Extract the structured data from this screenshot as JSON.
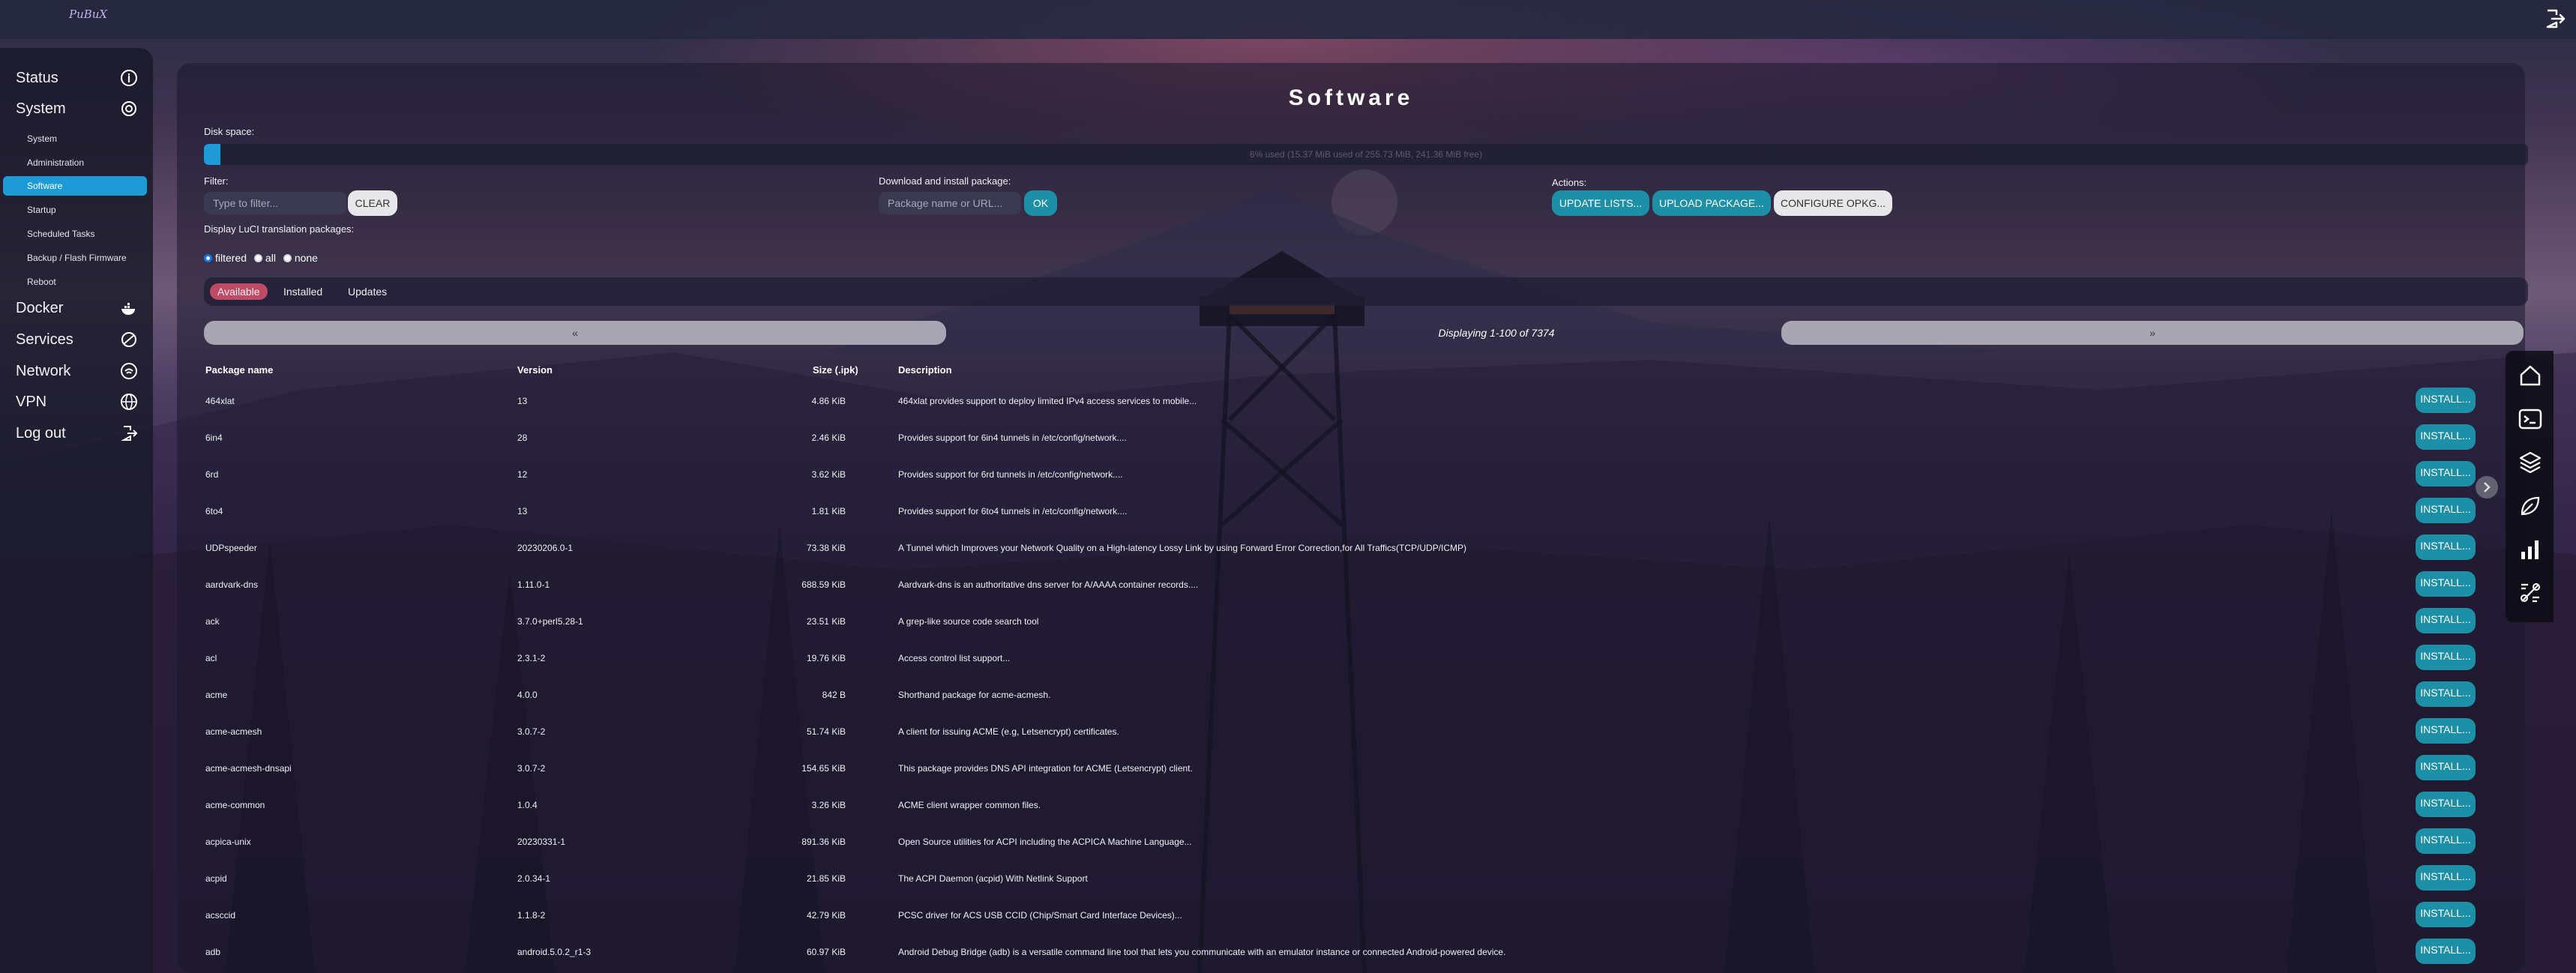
{
  "app": {
    "logo": "PuBuX"
  },
  "sidebar": {
    "items": [
      {
        "label": "Status",
        "icon": "info-circle-icon"
      },
      {
        "label": "System",
        "icon": "gear-icon"
      },
      {
        "label": "Docker",
        "icon": "whale-icon"
      },
      {
        "label": "Services",
        "icon": "services-icon"
      },
      {
        "label": "Network",
        "icon": "wifi-icon"
      },
      {
        "label": "VPN",
        "icon": "globe-icon"
      },
      {
        "label": "Log out",
        "icon": "logout-icon"
      }
    ],
    "system_sub": [
      "System",
      "Administration",
      "Software",
      "Startup",
      "Scheduled Tasks",
      "Backup / Flash Firmware",
      "Reboot"
    ],
    "active_sub": "Software"
  },
  "page": {
    "title": "Software",
    "disk_space_label": "Disk space:",
    "disk_text": "6% used (15.37 MiB used of 255.73 MiB, 241.36 MiB free)",
    "disk_used_fraction": 0.06,
    "filter_label": "Filter:",
    "filter_placeholder": "Type to filter...",
    "clear_label": "CLEAR",
    "download_label": "Download and install package:",
    "download_placeholder": "Package name or URL...",
    "ok_label": "OK",
    "actions_label": "Actions:",
    "update_lists_label": "UPDATE LISTS...",
    "upload_package_label": "UPLOAD PACKAGE...",
    "configure_opkg_label": "CONFIGURE OPKG...",
    "translation_label": "Display LuCI translation packages:",
    "radio": {
      "filtered": "filtered",
      "all": "all",
      "none": "none",
      "selected": "filtered"
    },
    "tabs": [
      "Available",
      "Installed",
      "Updates"
    ],
    "active_tab": "Available",
    "pager_prev": "«",
    "pager_next": "»",
    "pager_info": "Displaying 1-100 of 7374"
  },
  "table": {
    "headers": {
      "name": "Package name",
      "version": "Version",
      "size": "Size (.ipk)",
      "description": "Description"
    },
    "install_label": "INSTALL...",
    "rows": [
      {
        "name": "464xlat",
        "version": "13",
        "size": "4.86 KiB",
        "description": "464xlat provides support to deploy limited IPv4 access services to mobile..."
      },
      {
        "name": "6in4",
        "version": "28",
        "size": "2.46 KiB",
        "description": "Provides support for 6in4 tunnels in /etc/config/network...."
      },
      {
        "name": "6rd",
        "version": "12",
        "size": "3.62 KiB",
        "description": "Provides support for 6rd tunnels in /etc/config/network...."
      },
      {
        "name": "6to4",
        "version": "13",
        "size": "1.81 KiB",
        "description": "Provides support for 6to4 tunnels in /etc/config/network...."
      },
      {
        "name": "UDPspeeder",
        "version": "20230206.0-1",
        "size": "73.38 KiB",
        "description": "A Tunnel which Improves your Network Quality on a High-latency Lossy Link by using Forward Error Correction,for All Traffics(TCP/UDP/ICMP)"
      },
      {
        "name": "aardvark-dns",
        "version": "1.11.0-1",
        "size": "688.59 KiB",
        "description": "Aardvark-dns is an authoritative dns server for A/AAAA container records...."
      },
      {
        "name": "ack",
        "version": "3.7.0+perl5.28-1",
        "size": "23.51 KiB",
        "description": "A grep-like source code search tool"
      },
      {
        "name": "acl",
        "version": "2.3.1-2",
        "size": "19.76 KiB",
        "description": "Access control list support..."
      },
      {
        "name": "acme",
        "version": "4.0.0",
        "size": "842 B",
        "description": "Shorthand package for acme-acmesh."
      },
      {
        "name": "acme-acmesh",
        "version": "3.0.7-2",
        "size": "51.74 KiB",
        "description": "A client for issuing ACME (e.g, Letsencrypt) certificates."
      },
      {
        "name": "acme-acmesh-dnsapi",
        "version": "3.0.7-2",
        "size": "154.65 KiB",
        "description": "This package provides DNS API integration for ACME (Letsencrypt) client."
      },
      {
        "name": "acme-common",
        "version": "1.0.4",
        "size": "3.26 KiB",
        "description": "ACME client wrapper common files."
      },
      {
        "name": "acpica-unix",
        "version": "20230331-1",
        "size": "891.36 KiB",
        "description": "Open Source utilities for ACPI including the ACPICA Machine Language..."
      },
      {
        "name": "acpid",
        "version": "2.0.34-1",
        "size": "21.85 KiB",
        "description": "The ACPI Daemon (acpid) With Netlink Support"
      },
      {
        "name": "acsccid",
        "version": "1.1.8-2",
        "size": "42.79 KiB",
        "description": "PCSC driver for ACS USB CCID (Chip/Smart Card Interface Devices)..."
      },
      {
        "name": "adb",
        "version": "android.5.0.2_r1-3",
        "size": "60.97 KiB",
        "description": "Android Debug Bridge (adb) is a versatile command line tool that lets you communicate with an emulator instance or connected Android-powered device."
      }
    ]
  },
  "dock": {
    "icons": [
      "home-icon",
      "terminal-icon",
      "cube-stack-icon",
      "leaf-icon",
      "bar-chart-icon",
      "code-icon"
    ]
  },
  "colors": {
    "accent": "#1c9bd6",
    "install_button": "#1d8fa6",
    "active_tab": "#bf4a63"
  }
}
